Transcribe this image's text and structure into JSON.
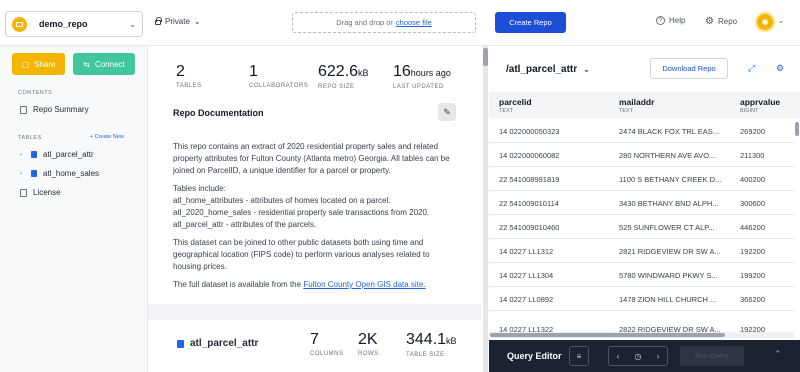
{
  "header": {
    "repo_name": "demo_repo",
    "visibility": "Private",
    "drop_text": "Drag and drop or",
    "drop_link": "choose file",
    "create_repo": "Create Repo",
    "help": "Help",
    "repo": "Repo"
  },
  "sidebar": {
    "share": "Share",
    "connect": "Connect",
    "contents_label": "CONTENTS",
    "repo_summary": "Repo Summary",
    "tables_label": "TABLES",
    "create_new": "+ Create New",
    "tables": [
      "atl_parcel_attr",
      "atl_home_sales"
    ],
    "license": "License"
  },
  "summary": {
    "stats": [
      {
        "value": "2",
        "unit": "",
        "label": "TABLES"
      },
      {
        "value": "1",
        "unit": "",
        "label": "COLLABORATORS"
      },
      {
        "value": "622.6",
        "unit": "kB",
        "label": "REPO SIZE"
      },
      {
        "value": "16",
        "unit": "hours ago",
        "label": "LAST UPDATED"
      }
    ],
    "doc_title": "Repo Documentation",
    "paragraphs": [
      "This repo contains an extract of 2020 residential property sales and related property attributes for Fulton County (Atlanta metro) Georgia. All tables can be joined on ParcelID, a unique identifier for a parcel or property.",
      "Tables include:",
      "atl_home_attributes - attributes of homes located on a parcel.",
      "atl_2020_home_sales - residential property sale transactions from 2020.",
      "atl_parcel_attr - attributes of the parcels.",
      "This dataset can be joined to other public datasets both using time and geographical location (FIPS code) to perform various analyses related to housing prices.",
      "The full dataset is available from the",
      "Fulton County Open GIS data site."
    ]
  },
  "table_card": {
    "name": "atl_parcel_attr",
    "stats": [
      {
        "value": "7",
        "unit": "",
        "label": "COLUMNS"
      },
      {
        "value": "2K",
        "unit": "",
        "label": "ROWS"
      },
      {
        "value": "344.1",
        "unit": "kB",
        "label": "TABLE SIZE"
      }
    ]
  },
  "preview": {
    "title": "/atl_parcel_attr",
    "download": "Download Repo",
    "columns": [
      {
        "name": "parcelid",
        "type": "TEXT"
      },
      {
        "name": "mailaddr",
        "type": "TEXT"
      },
      {
        "name": "apprvalue",
        "type": "BIGINT"
      }
    ],
    "rows": [
      [
        "14 022000050323",
        "2474 BLACK FOX TRL EAS...",
        "269200"
      ],
      [
        "14 022000060082",
        "280 NORTHERN AVE AVO...",
        "211300"
      ],
      [
        "22 541008991819",
        "1100 S BETHANY CREEK D...",
        "400200"
      ],
      [
        "22 541009010114",
        "3430 BETHANY BND ALPH...",
        "300600"
      ],
      [
        "22 541009010460",
        "525 SUNFLOWER CT ALP...",
        "446200"
      ],
      [
        "14 0227 LL1312",
        "2821 RIDGEVIEW DR SW A...",
        "192200"
      ],
      [
        "14 0227 LL1304",
        "5780 WINDWARD PKWY S...",
        "199200"
      ],
      [
        "14 0227 LL0892",
        "1478 ZION HILL CHURCH ...",
        "366200"
      ],
      [
        "14 0227 LL1322",
        "2822 RIDGEVIEW DR SW A...",
        "192200"
      ]
    ]
  },
  "query_editor": {
    "label": "Query Editor",
    "run": "Run Query"
  },
  "colors": {
    "accent": "#1d4ed8",
    "share": "#f5b400",
    "connect": "#43c59e",
    "editor_bg": "#1d2233"
  }
}
